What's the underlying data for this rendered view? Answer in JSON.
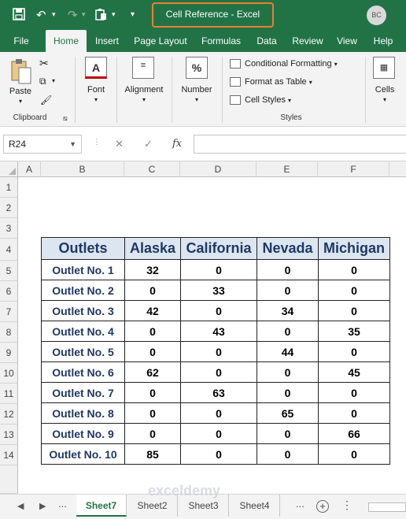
{
  "titlebar": {
    "title": "Cell Reference  -  Excel",
    "user_initials": "BC",
    "icons": [
      "save-icon",
      "undo-icon",
      "redo-icon",
      "paste-icon",
      "customize-icon"
    ]
  },
  "ribbon_tabs": [
    "File",
    "Home",
    "Insert",
    "Page Layout",
    "Formulas",
    "Data",
    "Review",
    "View",
    "Help"
  ],
  "active_tab": "Home",
  "ribbon": {
    "paste": "Paste",
    "clipboard": "Clipboard",
    "font": "Font",
    "alignment": "Alignment",
    "number": "Number",
    "conditional_formatting": "Conditional Formatting",
    "format_as_table": "Format as Table",
    "cell_styles": "Cell Styles",
    "styles": "Styles",
    "cells": "Cells"
  },
  "formula_bar": {
    "name_box": "R24",
    "fx": "fx",
    "cancel": "✕",
    "enter": "✓",
    "formula": ""
  },
  "columns": [
    "A",
    "B",
    "C",
    "D",
    "E",
    "F"
  ],
  "rows": [
    "1",
    "2",
    "3",
    "4",
    "5",
    "6",
    "7",
    "8",
    "9",
    "10",
    "11",
    "12",
    "13",
    "14"
  ],
  "table": {
    "headers": [
      "Outlets",
      "Alaska",
      "California",
      "Nevada",
      "Michigan"
    ],
    "rows": [
      [
        "Outlet No. 1",
        "32",
        "0",
        "0",
        "0"
      ],
      [
        "Outlet No. 2",
        "0",
        "33",
        "0",
        "0"
      ],
      [
        "Outlet No. 3",
        "42",
        "0",
        "34",
        "0"
      ],
      [
        "Outlet No. 4",
        "0",
        "43",
        "0",
        "35"
      ],
      [
        "Outlet No. 5",
        "0",
        "0",
        "44",
        "0"
      ],
      [
        "Outlet No. 6",
        "62",
        "0",
        "0",
        "45"
      ],
      [
        "Outlet No. 7",
        "0",
        "63",
        "0",
        "0"
      ],
      [
        "Outlet No. 8",
        "0",
        "0",
        "65",
        "0"
      ],
      [
        "Outlet No. 9",
        "0",
        "0",
        "0",
        "66"
      ],
      [
        "Outlet No. 10",
        "85",
        "0",
        "0",
        "0"
      ]
    ]
  },
  "sheets": [
    "Sheet7",
    "Sheet2",
    "Sheet3",
    "Sheet4"
  ],
  "active_sheet": "Sheet7",
  "sheet_overflow": "...",
  "watermark": "exceldemy",
  "colors": {
    "excel_green": "#217346",
    "title_highlight": "#ed7d31",
    "header_fill": "#dce6f1",
    "header_text": "#1f3864"
  }
}
